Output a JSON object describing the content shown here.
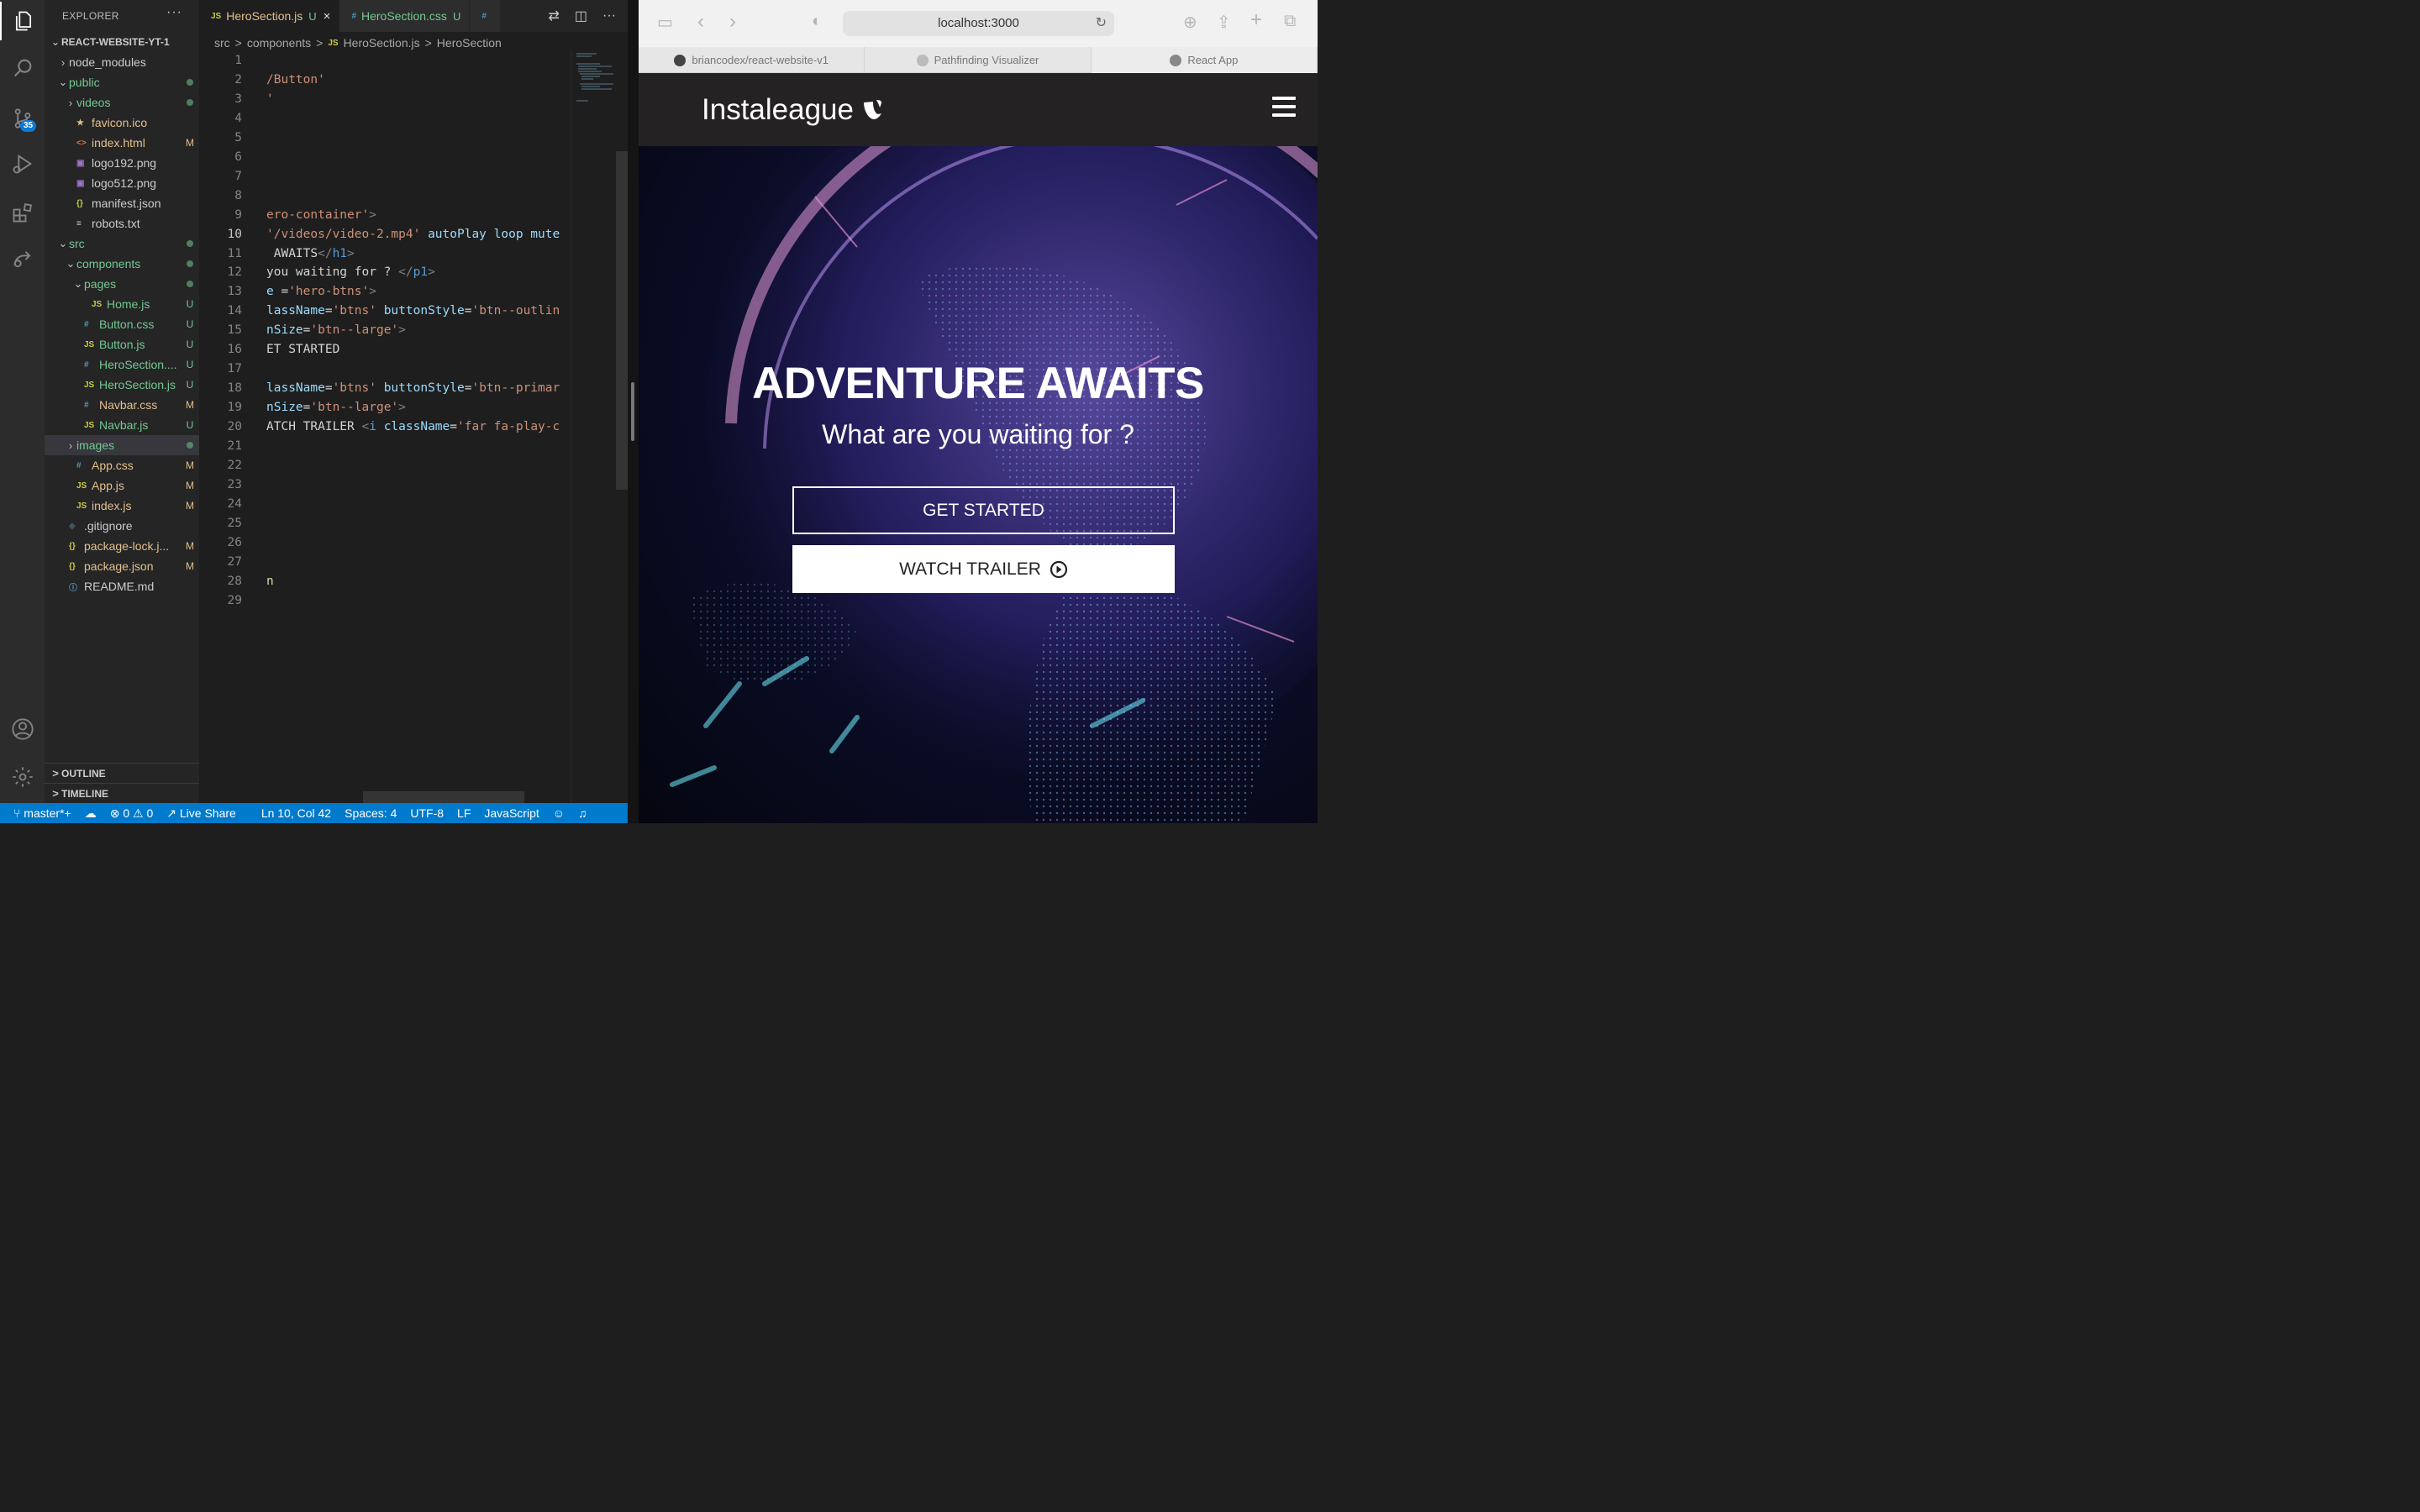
{
  "vscode": {
    "activity_badge": "35",
    "explorer_title": "EXPLORER",
    "tree": [
      {
        "depth": 0,
        "chev": "v",
        "icon": "",
        "color": "#ccc",
        "name": "REACT-WEBSITE-YT-1",
        "bold": true,
        "status": ""
      },
      {
        "depth": 1,
        "chev": ">",
        "icon": "",
        "color": "#ccc",
        "name": "node_modules",
        "status": ""
      },
      {
        "depth": 1,
        "chev": "v",
        "icon": "",
        "color": "#73c991",
        "name": "public",
        "status": "dot"
      },
      {
        "depth": 2,
        "chev": ">",
        "icon": "",
        "color": "#73c991",
        "name": "videos",
        "status": "dot"
      },
      {
        "depth": 2,
        "chev": "",
        "icon": "★",
        "iconColor": "#e2c08d",
        "color": "#e2c08d",
        "name": "favicon.ico",
        "status": ""
      },
      {
        "depth": 2,
        "chev": "",
        "icon": "<>",
        "iconColor": "#e37933",
        "color": "#e2c08d",
        "name": "index.html",
        "status": "M"
      },
      {
        "depth": 2,
        "chev": "",
        "icon": "▣",
        "iconColor": "#a074c4",
        "color": "#ccc",
        "name": "logo192.png",
        "status": ""
      },
      {
        "depth": 2,
        "chev": "",
        "icon": "▣",
        "iconColor": "#a074c4",
        "color": "#ccc",
        "name": "logo512.png",
        "status": ""
      },
      {
        "depth": 2,
        "chev": "",
        "icon": "{}",
        "iconColor": "#cbcb41",
        "color": "#ccc",
        "name": "manifest.json",
        "status": ""
      },
      {
        "depth": 2,
        "chev": "",
        "icon": "≡",
        "iconColor": "#ccc",
        "color": "#ccc",
        "name": "robots.txt",
        "status": ""
      },
      {
        "depth": 1,
        "chev": "v",
        "icon": "",
        "color": "#73c991",
        "name": "src",
        "status": "dot"
      },
      {
        "depth": 2,
        "chev": "v",
        "icon": "",
        "color": "#73c991",
        "name": "components",
        "status": "dot"
      },
      {
        "depth": 3,
        "chev": "v",
        "icon": "",
        "color": "#73c991",
        "name": "pages",
        "status": "dot"
      },
      {
        "depth": 4,
        "chev": "",
        "icon": "JS",
        "iconColor": "#cbcb41",
        "color": "#73c991",
        "name": "Home.js",
        "status": "U"
      },
      {
        "depth": 3,
        "chev": "",
        "icon": "#",
        "iconColor": "#519aba",
        "color": "#73c991",
        "name": "Button.css",
        "status": "U"
      },
      {
        "depth": 3,
        "chev": "",
        "icon": "JS",
        "iconColor": "#cbcb41",
        "color": "#73c991",
        "name": "Button.js",
        "status": "U"
      },
      {
        "depth": 3,
        "chev": "",
        "icon": "#",
        "iconColor": "#519aba",
        "color": "#73c991",
        "name": "HeroSection....",
        "status": "U"
      },
      {
        "depth": 3,
        "chev": "",
        "icon": "JS",
        "iconColor": "#cbcb41",
        "color": "#73c991",
        "name": "HeroSection.js",
        "status": "U"
      },
      {
        "depth": 3,
        "chev": "",
        "icon": "#",
        "iconColor": "#519aba",
        "color": "#e2c08d",
        "name": "Navbar.css",
        "status": "M"
      },
      {
        "depth": 3,
        "chev": "",
        "icon": "JS",
        "iconColor": "#cbcb41",
        "color": "#73c991",
        "name": "Navbar.js",
        "status": "U"
      },
      {
        "depth": 2,
        "chev": ">",
        "icon": "",
        "color": "#73c991",
        "name": "images",
        "status": "dot",
        "selected": true
      },
      {
        "depth": 2,
        "chev": "",
        "icon": "#",
        "iconColor": "#519aba",
        "color": "#e2c08d",
        "name": "App.css",
        "status": "M"
      },
      {
        "depth": 2,
        "chev": "",
        "icon": "JS",
        "iconColor": "#cbcb41",
        "color": "#e2c08d",
        "name": "App.js",
        "status": "M"
      },
      {
        "depth": 2,
        "chev": "",
        "icon": "JS",
        "iconColor": "#cbcb41",
        "color": "#e2c08d",
        "name": "index.js",
        "status": "M"
      },
      {
        "depth": 1,
        "chev": "",
        "icon": "◆",
        "iconColor": "#41535b",
        "color": "#ccc",
        "name": ".gitignore",
        "status": ""
      },
      {
        "depth": 1,
        "chev": "",
        "icon": "{}",
        "iconColor": "#cbcb41",
        "color": "#e2c08d",
        "name": "package-lock.j...",
        "status": "M"
      },
      {
        "depth": 1,
        "chev": "",
        "icon": "{}",
        "iconColor": "#cbcb41",
        "color": "#e2c08d",
        "name": "package.json",
        "status": "M"
      },
      {
        "depth": 1,
        "chev": "",
        "icon": "ⓘ",
        "iconColor": "#519aba",
        "color": "#ccc",
        "name": "README.md",
        "status": ""
      }
    ],
    "outline_label": "OUTLINE",
    "timeline_label": "TIMELINE",
    "tabs": [
      {
        "icon": "JS",
        "iconColor": "#cbcb41",
        "label": "HeroSection.js",
        "status": "U",
        "active": true,
        "close": "×"
      },
      {
        "icon": "#",
        "iconColor": "#519aba",
        "label": "HeroSection.css",
        "status": "U",
        "active": false,
        "close": ""
      },
      {
        "icon": "#",
        "iconColor": "#519aba",
        "label": "",
        "status": "",
        "active": false,
        "close": ""
      }
    ],
    "breadcrumb": [
      "src",
      ">",
      "components",
      ">",
      "JS",
      "HeroSection.js",
      ">",
      "HeroSection"
    ],
    "code_lines": [
      {
        "n": "1",
        "html": ""
      },
      {
        "n": "2",
        "html": "<span class='s'>/Button'</span>"
      },
      {
        "n": "3",
        "html": "<span class='s'>'</span>"
      },
      {
        "n": "4",
        "html": ""
      },
      {
        "n": "5",
        "html": ""
      },
      {
        "n": "6",
        "html": ""
      },
      {
        "n": "7",
        "html": ""
      },
      {
        "n": "8",
        "html": ""
      },
      {
        "n": "9",
        "html": "<span class='s'>ero-container'</span><span class='t'>&gt;</span>"
      },
      {
        "n": "10",
        "html": "<span class='s'>'/videos/video-2.mp4'</span> <span class='a'>autoPlay</span> <span class='a'>loop</span> <span class='a'>mute</span>",
        "cur": true
      },
      {
        "n": "11",
        "html": " AWAITS<span class='t'>&lt;/</span><span class='k'>h1</span><span class='t'>&gt;</span>"
      },
      {
        "n": "12",
        "html": "you waiting for ? <span class='t'>&lt;/</span><span class='k'>p1</span><span class='t'>&gt;</span>"
      },
      {
        "n": "13",
        "html": "<span class='a'>e</span> =<span class='s'>'hero-btns'</span><span class='t'>&gt;</span>"
      },
      {
        "n": "14",
        "html": "<span class='a'>lassName</span>=<span class='s'>'btns'</span> <span class='a'>buttonStyle</span>=<span class='s'>'btn--outlin</span>"
      },
      {
        "n": "15",
        "html": "<span class='a'>nSize</span>=<span class='s'>'btn--large'</span><span class='t'>&gt;</span>"
      },
      {
        "n": "16",
        "html": "ET STARTED"
      },
      {
        "n": "17",
        "html": ""
      },
      {
        "n": "18",
        "html": "<span class='a'>lassName</span>=<span class='s'>'btns'</span> <span class='a'>buttonStyle</span>=<span class='s'>'btn--primar</span>"
      },
      {
        "n": "19",
        "html": "<span class='a'>nSize</span>=<span class='s'>'btn--large'</span><span class='t'>&gt;</span>"
      },
      {
        "n": "20",
        "html": "ATCH TRAILER <span class='t'>&lt;</span><span class='k'>i</span> <span class='a'>className</span>=<span class='s'>'far fa-play-c</span>"
      },
      {
        "n": "21",
        "html": ""
      },
      {
        "n": "22",
        "html": ""
      },
      {
        "n": "23",
        "html": ""
      },
      {
        "n": "24",
        "html": ""
      },
      {
        "n": "25",
        "html": ""
      },
      {
        "n": "26",
        "html": ""
      },
      {
        "n": "27",
        "html": ""
      },
      {
        "n": "28",
        "html": "<span class='y'>n</span>"
      },
      {
        "n": "29",
        "html": ""
      }
    ],
    "status": {
      "branch": "master*+",
      "problems": "⊗ 0 ⚠ 0",
      "live_share": "Live Share",
      "position": "Ln 10, Col 42",
      "spaces": "Spaces: 4",
      "encoding": "UTF-8",
      "eol": "LF",
      "language": "JavaScript"
    }
  },
  "browser": {
    "url": "localhost:3000",
    "tabs": [
      {
        "label": "briancodex/react-website-v1",
        "iconColor": "#444"
      },
      {
        "label": "Pathfinding Visualizer",
        "iconColor": "#bbb"
      },
      {
        "label": "React App",
        "iconColor": "#888"
      }
    ],
    "site": {
      "logo": "Instaleague",
      "hero_title": "ADVENTURE AWAITS",
      "hero_subtitle": "What are you waiting for ?",
      "btn_get_started": "GET STARTED",
      "btn_watch_trailer": "WATCH TRAILER"
    }
  }
}
